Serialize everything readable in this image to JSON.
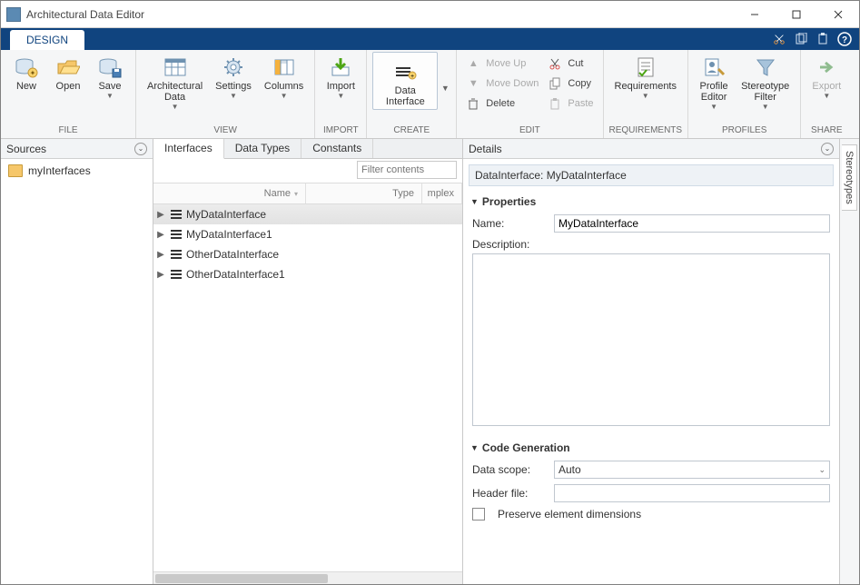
{
  "app": {
    "title": "Architectural Data Editor"
  },
  "ribbon": {
    "tab": "DESIGN",
    "groups": {
      "file": {
        "label": "FILE",
        "new": "New",
        "open": "Open",
        "save": "Save"
      },
      "view": {
        "label": "VIEW",
        "archdata": "Architectural\nData",
        "settings": "Settings",
        "columns": "Columns"
      },
      "import": {
        "label": "IMPORT",
        "import": "Import"
      },
      "create": {
        "label": "CREATE",
        "datainterface": "Data\nInterface"
      },
      "edit": {
        "label": "EDIT",
        "moveup": "Move Up",
        "movedown": "Move Down",
        "delete": "Delete",
        "cut": "Cut",
        "copy": "Copy",
        "paste": "Paste"
      },
      "requirements": {
        "label": "REQUIREMENTS",
        "requirements": "Requirements"
      },
      "profiles": {
        "label": "PROFILES",
        "profile": "Profile\nEditor",
        "stereotype": "Stereotype\nFilter"
      },
      "share": {
        "label": "SHARE",
        "export": "Export"
      }
    }
  },
  "panels": {
    "sources": {
      "title": "Sources",
      "item": "myInterfaces"
    },
    "tabs": {
      "interfaces": "Interfaces",
      "datatypes": "Data Types",
      "constants": "Constants"
    },
    "filter_placeholder": "Filter contents",
    "columns": {
      "name": "Name",
      "type": "Type",
      "mplex": "mplex"
    },
    "rows": [
      "MyDataInterface",
      "MyDataInterface1",
      "OtherDataInterface",
      "OtherDataInterface1"
    ],
    "details": {
      "title": "Details",
      "breadcrumb": "DataInterface: MyDataInterface",
      "properties": "Properties",
      "name_label": "Name:",
      "name_value": "MyDataInterface",
      "description_label": "Description:",
      "codegen": "Code Generation",
      "datascope_label": "Data scope:",
      "datascope_value": "Auto",
      "headerfile_label": "Header file:",
      "preserve": "Preserve element dimensions"
    },
    "stereotypes": "Stereotypes"
  }
}
